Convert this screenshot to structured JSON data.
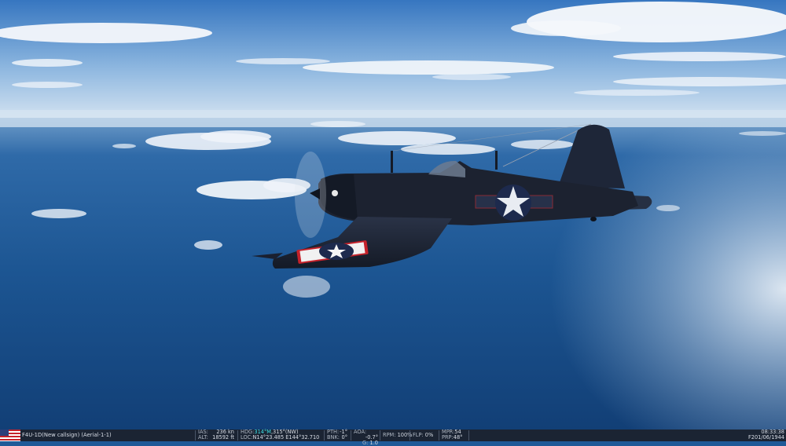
{
  "hud": {
    "unit_label": "F4U-1D(New callsign) (Aerial-1-1)",
    "flag_icon": "us-flag-icon",
    "ias_label": "IAS:",
    "ias_value": "236 kn",
    "alt_label": "ALT:",
    "alt_value": "18592 ft",
    "hdg_label": "HDG:",
    "hdg_true": "314°M",
    "hdg_mag": ",315°(NW)",
    "loc_label": "LOC:",
    "loc_value": "N14°23.485 E144°32.710",
    "pth_label": "PTH:",
    "pth_value": "-1°",
    "bnk_label": "BNK:",
    "bnk_value": "0°",
    "aoa_label": "AOA:",
    "aoa_value": "-0.7°",
    "g_label": "G:",
    "g_value": "1.0",
    "rpm_label": "RPM:",
    "rpm_value": "100%",
    "flp_label": "FLP:",
    "flp_value": "0%",
    "mpr_label": "MPR:",
    "mpr_value": "54",
    "prp_label": "PRP:",
    "prp_value": "48°",
    "time": "08:33:38",
    "date": "F201/06/1944"
  },
  "colors": {
    "sky_top": "#3f7fc6",
    "horizon": "#dbe7f2",
    "sea_deep": "#12467f",
    "aircraft_body": "#1c2230",
    "hud_highlight": "#3fe0e8"
  }
}
